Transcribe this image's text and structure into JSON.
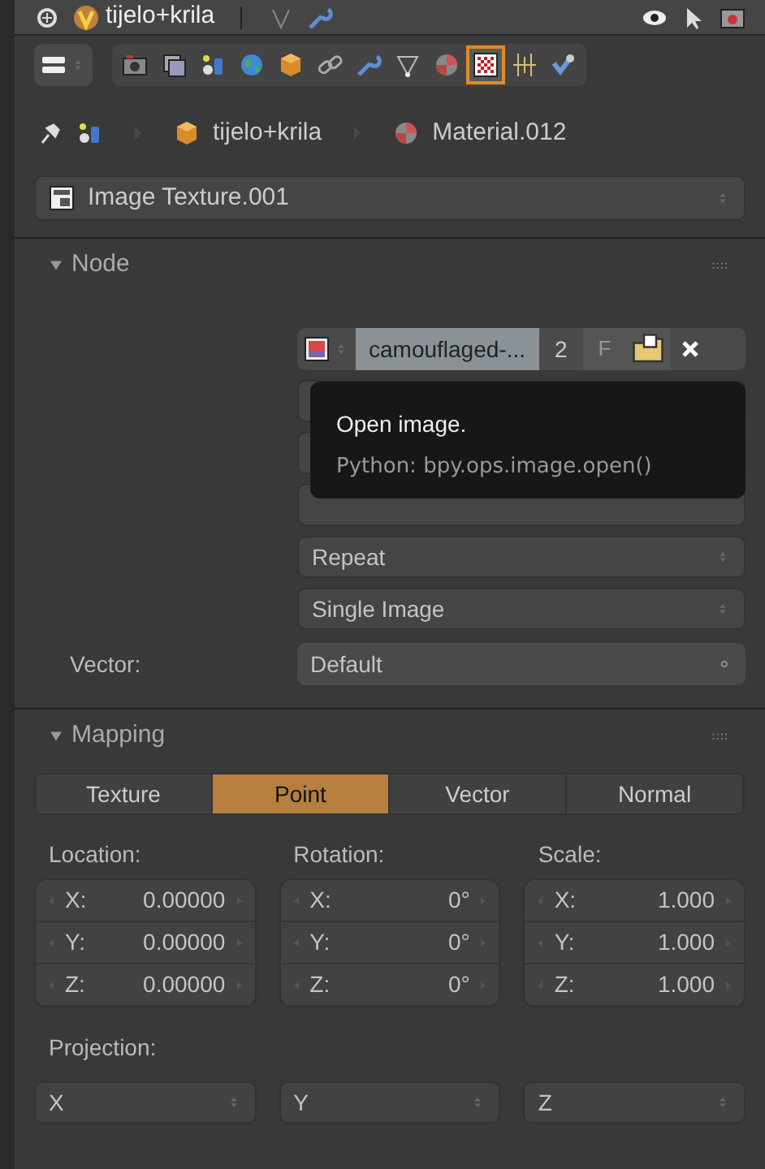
{
  "header": {
    "object_name": "tijelo+krila"
  },
  "context_tabs": [
    {
      "kind": "render",
      "selected": false
    },
    {
      "kind": "layers",
      "selected": false
    },
    {
      "kind": "scene",
      "selected": false
    },
    {
      "kind": "world",
      "selected": false
    },
    {
      "kind": "object",
      "selected": false
    },
    {
      "kind": "constraints",
      "selected": false
    },
    {
      "kind": "modifiers",
      "selected": false
    },
    {
      "kind": "data",
      "selected": false
    },
    {
      "kind": "material",
      "selected": false
    },
    {
      "kind": "texture",
      "selected": true
    },
    {
      "kind": "particles",
      "selected": false
    },
    {
      "kind": "physics",
      "selected": false
    }
  ],
  "breadcrumb": [
    {
      "kind": "object",
      "label": "tijelo+krila"
    },
    {
      "kind": "material",
      "label": "Material.012"
    }
  ],
  "texture_selector": {
    "value": "Image Texture.001"
  },
  "node_panel": {
    "title": "Node",
    "expanded": true,
    "image": {
      "name": "camouflaged-...",
      "users": "2",
      "fake_user": "F"
    },
    "tooltip": {
      "title": "Open image.",
      "python": "Python: bpy.ops.image.open()"
    },
    "dropdowns": [
      "Repeat",
      "Single Image"
    ],
    "vector": {
      "label": "Vector:",
      "value": "Default"
    }
  },
  "mapping_panel": {
    "title": "Mapping",
    "expanded": true,
    "tabs": [
      {
        "label": "Texture",
        "selected": false
      },
      {
        "label": "Point",
        "selected": true
      },
      {
        "label": "Vector",
        "selected": false
      },
      {
        "label": "Normal",
        "selected": false
      }
    ],
    "groups": [
      {
        "label": "Location:",
        "fields": [
          {
            "axis": "X:",
            "value": "0.00000"
          },
          {
            "axis": "Y:",
            "value": "0.00000"
          },
          {
            "axis": "Z:",
            "value": "0.00000"
          }
        ]
      },
      {
        "label": "Rotation:",
        "fields": [
          {
            "axis": "X:",
            "value": "0°"
          },
          {
            "axis": "Y:",
            "value": "0°"
          },
          {
            "axis": "Z:",
            "value": "0°"
          }
        ]
      },
      {
        "label": "Scale:",
        "fields": [
          {
            "axis": "X:",
            "value": "1.000"
          },
          {
            "axis": "Y:",
            "value": "1.000"
          },
          {
            "axis": "Z:",
            "value": "1.000"
          }
        ]
      }
    ],
    "projection": {
      "label": "Projection:",
      "options": [
        "X",
        "Y",
        "Z"
      ]
    }
  }
}
